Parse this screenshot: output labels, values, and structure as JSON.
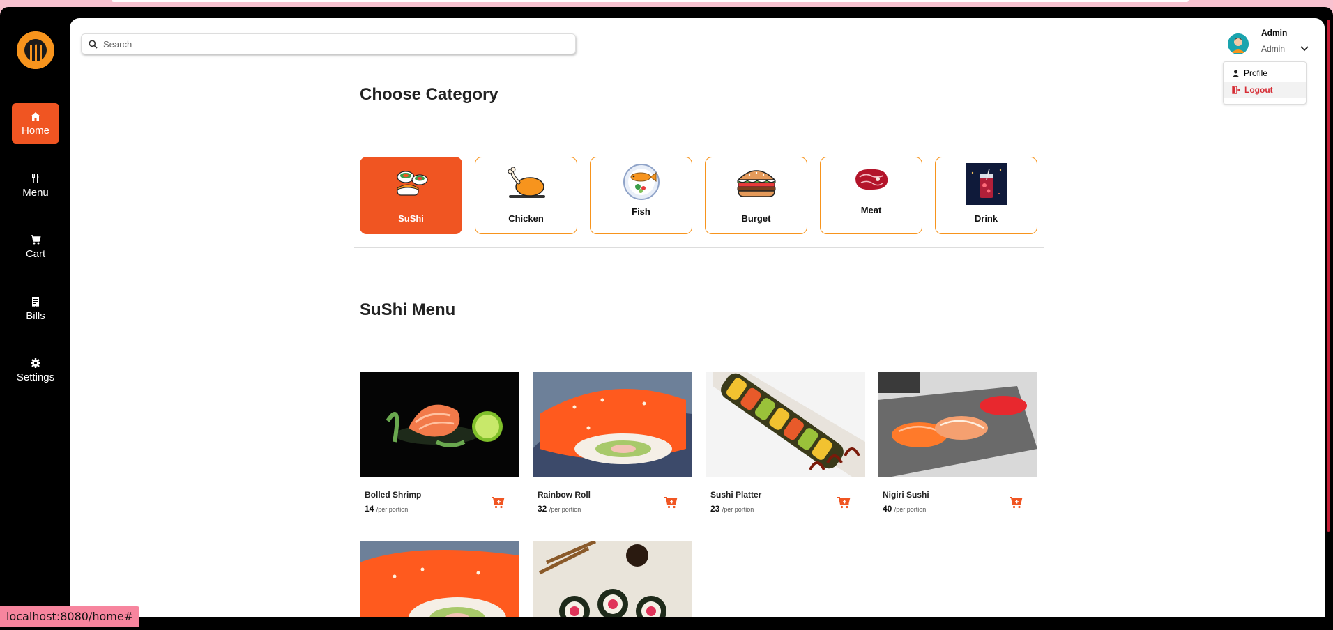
{
  "search": {
    "placeholder": "Search"
  },
  "sidebar": {
    "items": [
      {
        "label": "Home",
        "icon": "home-icon",
        "active": true
      },
      {
        "label": "Menu",
        "icon": "utensils-icon"
      },
      {
        "label": "Cart",
        "icon": "cart-icon"
      },
      {
        "label": "Bills",
        "icon": "receipt-icon"
      },
      {
        "label": "Settings",
        "icon": "gear-icon"
      }
    ]
  },
  "user": {
    "name": "Admin",
    "role": "Admin",
    "menu": [
      {
        "label": "Profile",
        "icon": "user-icon"
      },
      {
        "label": "Logout",
        "icon": "logout-icon"
      }
    ]
  },
  "categories": {
    "title": "Choose Category",
    "items": [
      {
        "label": "SuShi",
        "active": true
      },
      {
        "label": "Chicken"
      },
      {
        "label": "Fish"
      },
      {
        "label": "Burget"
      },
      {
        "label": "Meat"
      },
      {
        "label": "Drink"
      }
    ]
  },
  "menu": {
    "title": "SuShi Menu",
    "unit": "/per portion",
    "items": [
      {
        "name": "Bolled Shrimp",
        "price": "14"
      },
      {
        "name": "Rainbow Roll",
        "price": "32"
      },
      {
        "name": "Sushi Platter",
        "price": "23"
      },
      {
        "name": "Nigiri Sushi",
        "price": "40"
      }
    ]
  },
  "status_url": "localhost:8080/home#",
  "colors": {
    "accent": "#f05522",
    "border": "#f7941d",
    "sidebar": "#000000",
    "logout": "#d62d35"
  }
}
